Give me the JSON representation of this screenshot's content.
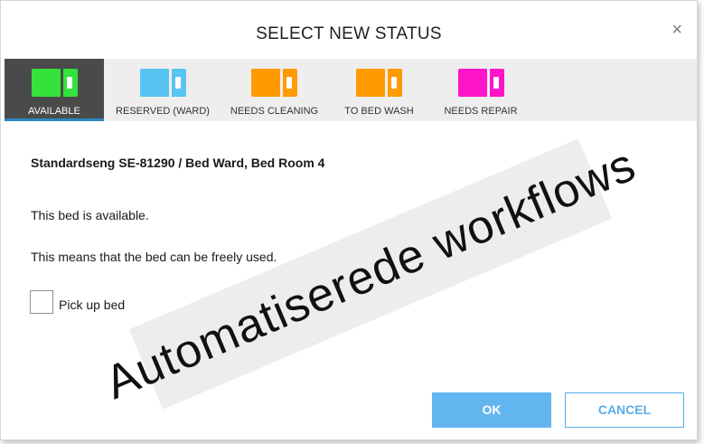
{
  "dialog": {
    "title": "SELECT NEW STATUS",
    "close_glyph": "×"
  },
  "tabs": [
    {
      "label": "AVAILABLE",
      "color": "#33e23a",
      "active": true,
      "icon": "bed-icon"
    },
    {
      "label": "RESERVED (WARD)",
      "color": "#58c4f2",
      "active": false,
      "icon": "bed-icon"
    },
    {
      "label": "NEEDS CLEANING",
      "color": "#ff9a00",
      "active": false,
      "icon": "bed-icon"
    },
    {
      "label": "TO BED WASH",
      "color": "#ff9a00",
      "active": false,
      "icon": "bed-icon"
    },
    {
      "label": "NEEDS REPAIR",
      "color": "#ff14c8",
      "active": false,
      "icon": "bed-icon"
    }
  ],
  "content": {
    "bed_title": "Standardseng SE-81290 / Bed Ward, Bed Room 4",
    "line1": "This bed is available.",
    "line2": "This means that the bed can be freely used.",
    "checkbox_label": "Pick up bed",
    "checkbox_checked": false
  },
  "buttons": {
    "ok": "OK",
    "cancel": "CANCEL"
  },
  "watermark": "Automatiserede workflows",
  "colors": {
    "active_tab_bg": "#4a4a4a",
    "active_indicator": "#2f86c6",
    "ok_bg": "#63b5f0",
    "cancel_text": "#5aaee8"
  }
}
